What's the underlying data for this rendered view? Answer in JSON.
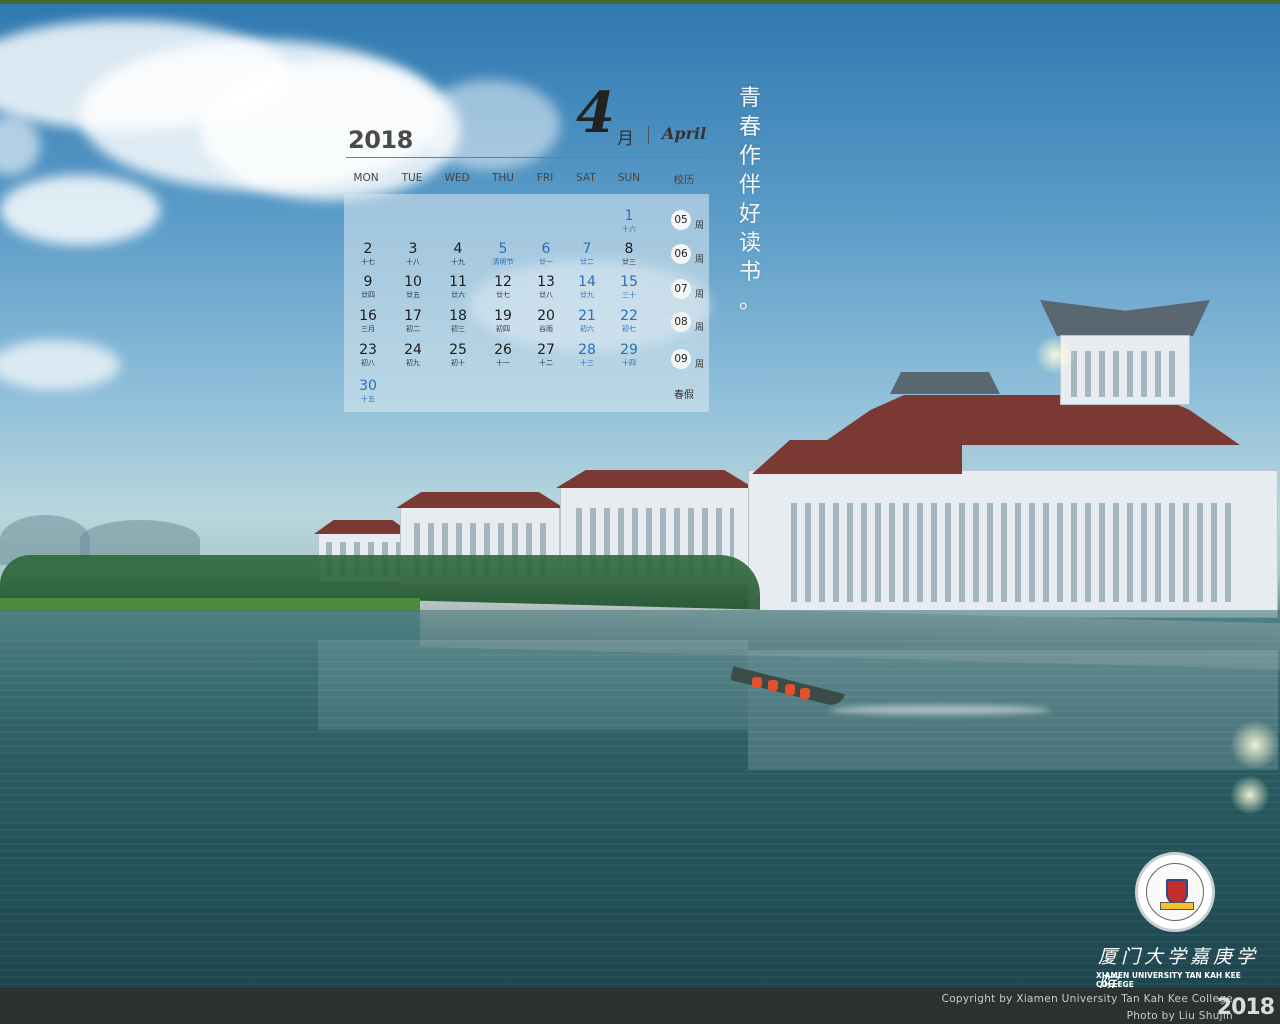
{
  "calendar": {
    "year": "2018",
    "month_num": "4",
    "month_cn": "月",
    "month_en": "April",
    "weekdays": [
      "MON",
      "TUE",
      "WED",
      "THU",
      "FRI",
      "SAT",
      "SUN"
    ],
    "school_calendar_label": "校历",
    "days": [
      {
        "n": "1",
        "l": "十六",
        "blue": true
      },
      {
        "n": "2",
        "l": "十七"
      },
      {
        "n": "3",
        "l": "十八"
      },
      {
        "n": "4",
        "l": "十九"
      },
      {
        "n": "5",
        "l": "清明节",
        "blue": true
      },
      {
        "n": "6",
        "l": "廿一",
        "blue": true
      },
      {
        "n": "7",
        "l": "廿二",
        "blue": true
      },
      {
        "n": "8",
        "l": "廿三"
      },
      {
        "n": "9",
        "l": "廿四"
      },
      {
        "n": "10",
        "l": "廿五"
      },
      {
        "n": "11",
        "l": "廿六"
      },
      {
        "n": "12",
        "l": "廿七"
      },
      {
        "n": "13",
        "l": "廿八"
      },
      {
        "n": "14",
        "l": "廿九",
        "blue": true
      },
      {
        "n": "15",
        "l": "三十",
        "blue": true
      },
      {
        "n": "16",
        "l": "三月"
      },
      {
        "n": "17",
        "l": "初二"
      },
      {
        "n": "18",
        "l": "初三"
      },
      {
        "n": "19",
        "l": "初四"
      },
      {
        "n": "20",
        "l": "谷雨"
      },
      {
        "n": "21",
        "l": "初六",
        "blue": true
      },
      {
        "n": "22",
        "l": "初七",
        "blue": true
      },
      {
        "n": "23",
        "l": "初八"
      },
      {
        "n": "24",
        "l": "初九"
      },
      {
        "n": "25",
        "l": "初十"
      },
      {
        "n": "26",
        "l": "十一"
      },
      {
        "n": "27",
        "l": "十二"
      },
      {
        "n": "28",
        "l": "十三",
        "blue": true
      },
      {
        "n": "29",
        "l": "十四",
        "blue": true
      },
      {
        "n": "30",
        "l": "十五",
        "blue": true
      }
    ],
    "weeks": [
      {
        "no": "05",
        "suffix": "周"
      },
      {
        "no": "06",
        "suffix": "周"
      },
      {
        "no": "07",
        "suffix": "周"
      },
      {
        "no": "08",
        "suffix": "周"
      },
      {
        "no": "09",
        "suffix": "周"
      }
    ],
    "holiday_label": "春假"
  },
  "slogan": [
    "青",
    "春",
    "作",
    "伴",
    "好",
    "读",
    "书",
    "。"
  ],
  "logo": {
    "college_cn": "厦门大学嘉庚学院",
    "college_en": "XIAMEN UNIVERSITY TAN KAH KEE COLLEGE"
  },
  "footer": {
    "copyright": "Copyright by Xiamen University Tan Kah Kee College",
    "photo": "Photo by Liu Shujin",
    "year": "2018"
  },
  "colors": {
    "holiday_blue": "#2a6fb8",
    "footer_bg": "#2b3231"
  }
}
